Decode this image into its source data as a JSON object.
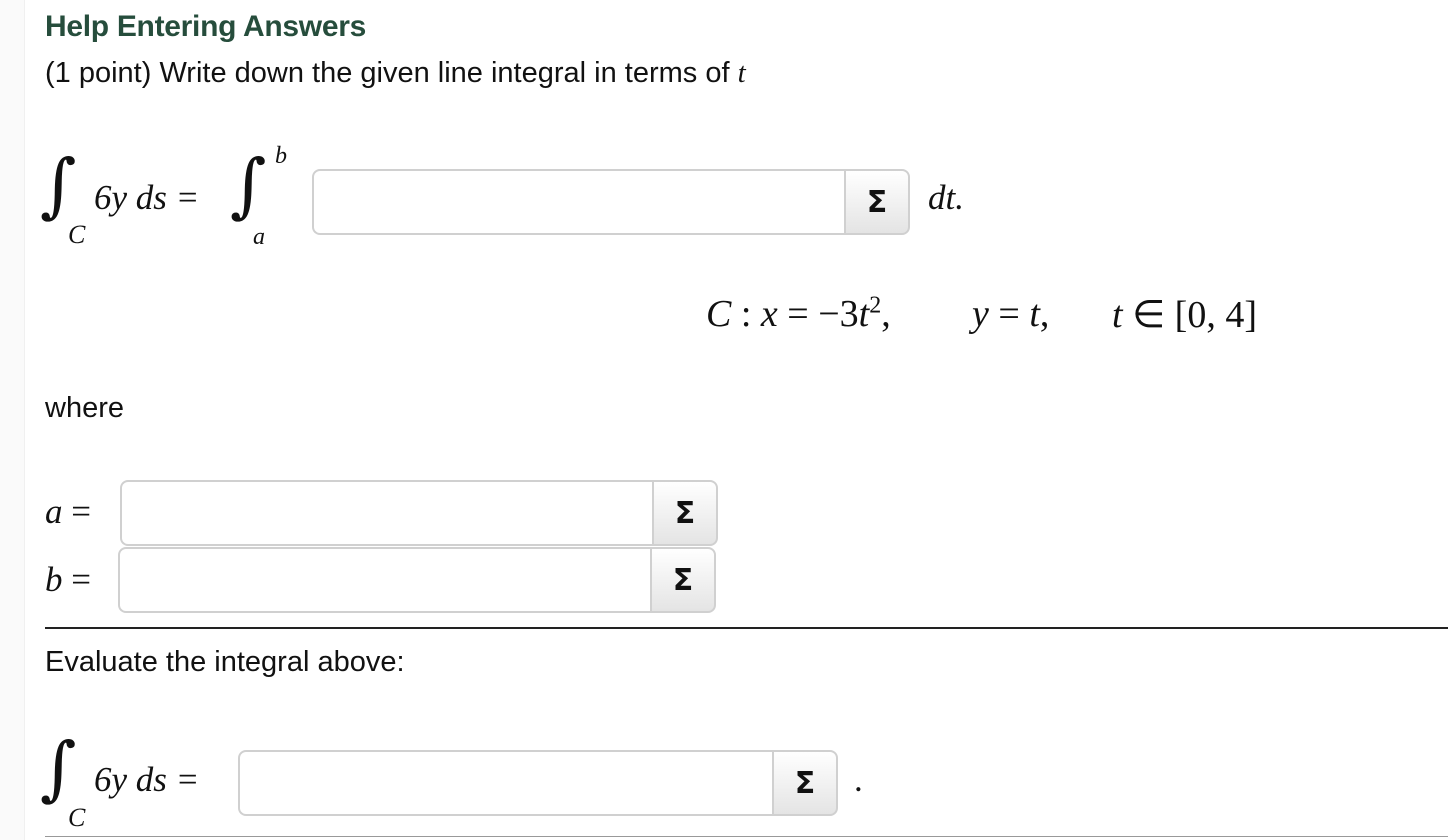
{
  "help_link": "Help Entering Answers",
  "problem": {
    "prefix": "(1 point) Write down the given line integral in terms of ",
    "var": "t"
  },
  "integral1": {
    "lhs_integrand": "6y ds =",
    "lhs_lower": "C",
    "upper_limit": "b",
    "lower_limit": "a",
    "trailing": "dt."
  },
  "curve": {
    "part1_C": "C",
    "part1_colon": " : ",
    "part1_x": "x",
    "part1_eq": " = −3",
    "part1_t": "t",
    "part1_exp": "2",
    "part1_comma": ",",
    "part2_y": "y",
    "part2_eq": " = ",
    "part2_t": "t",
    "part2_comma": ",",
    "part3_t": "t",
    "part3_rest": " ∈ [0, 4]"
  },
  "where_label": "where",
  "a_label": "a",
  "b_label": "b",
  "equals": "=",
  "evaluate_label": "Evaluate the integral above:",
  "integral2": {
    "lhs_integrand": "6y ds =",
    "lhs_lower": "C",
    "trailing": "."
  },
  "sigma_symbol": "Σ",
  "inputs": {
    "integrand_value": "",
    "a_value": "",
    "b_value": "",
    "result_value": ""
  },
  "colors": {
    "help_link": "#264d3c",
    "input_border": "#d0d0d0"
  }
}
